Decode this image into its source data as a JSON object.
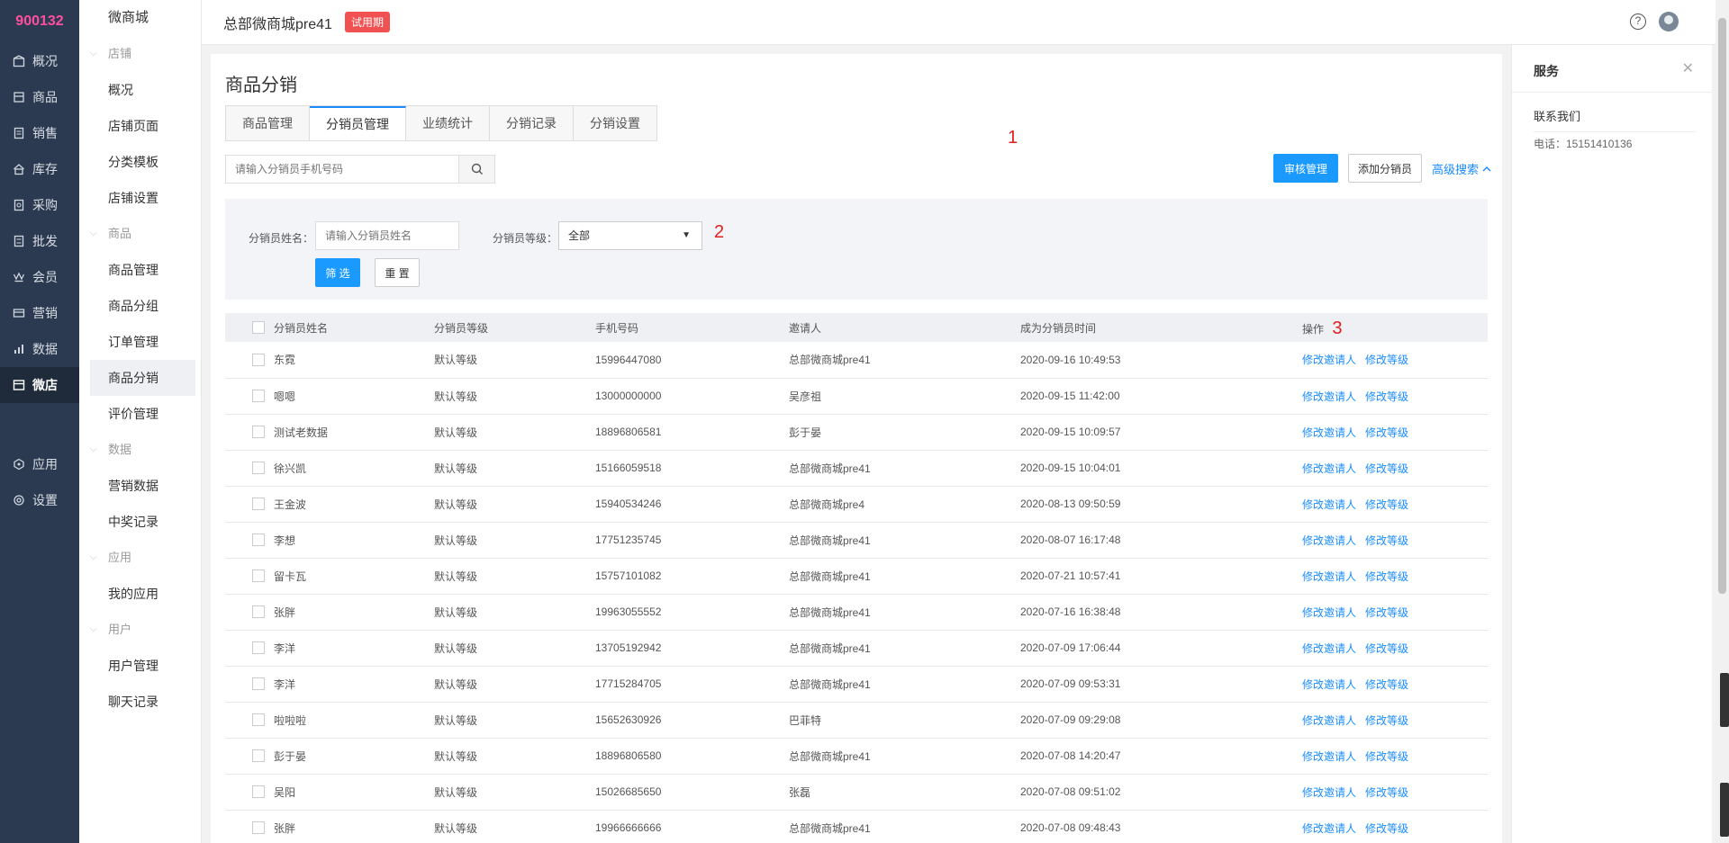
{
  "rail": {
    "store_id": "900132",
    "items": [
      {
        "label": "概况",
        "icon": "overview-icon"
      },
      {
        "label": "商品",
        "icon": "goods-icon"
      },
      {
        "label": "销售",
        "icon": "sales-icon"
      },
      {
        "label": "库存",
        "icon": "stock-icon"
      },
      {
        "label": "采购",
        "icon": "purchase-icon"
      },
      {
        "label": "批发",
        "icon": "wholesale-icon"
      },
      {
        "label": "会员",
        "icon": "member-icon"
      },
      {
        "label": "营销",
        "icon": "marketing-icon"
      },
      {
        "label": "数据",
        "icon": "data-icon"
      },
      {
        "label": "微店",
        "icon": "shop-icon"
      }
    ],
    "bottom_items": [
      {
        "label": "应用",
        "icon": "app-icon"
      },
      {
        "label": "设置",
        "icon": "settings-icon"
      }
    ]
  },
  "subnav": {
    "title": "微商城",
    "groups": [
      {
        "label": "店铺",
        "links": [
          "概况",
          "店铺页面",
          "分类模板",
          "店铺设置"
        ]
      },
      {
        "label": "商品",
        "links": [
          "商品管理",
          "商品分组",
          "订单管理",
          "商品分销",
          "评价管理"
        ]
      },
      {
        "label": "数据",
        "links": [
          "营销数据",
          "中奖记录"
        ]
      },
      {
        "label": "应用",
        "links": [
          "我的应用"
        ]
      },
      {
        "label": "用户",
        "links": [
          "用户管理",
          "聊天记录"
        ]
      }
    ]
  },
  "header": {
    "shop_name": "总部微商城pre41",
    "trial_badge": "试用期",
    "help": "?"
  },
  "main": {
    "page_title": "商品分销",
    "tabs": [
      "商品管理",
      "分销员管理",
      "业绩统计",
      "分销记录",
      "分销设置"
    ],
    "search_placeholder": "请输入分销员手机号码",
    "markers": [
      "1",
      "2",
      "3"
    ],
    "btn_review": "审核管理",
    "btn_add": "添加分销员",
    "advanced_search": "高级搜索",
    "filter": {
      "name_label": "分销员姓名：",
      "name_placeholder": "请输入分销员姓名",
      "level_label": "分销员等级：",
      "level_value": "全部",
      "btn_filter": "筛 选",
      "btn_reset": "重 置"
    },
    "table": {
      "columns": [
        "分销员姓名",
        "分销员等级",
        "手机号码",
        "邀请人",
        "成为分销员时间",
        "操作"
      ],
      "action_edit_inviter": "修改邀请人",
      "action_edit_level": "修改等级",
      "rows": [
        [
          "东霓",
          "默认等级",
          "15996447080",
          "总部微商城pre41",
          "2020-09-16 10:49:53"
        ],
        [
          "嗯嗯",
          "默认等级",
          "13000000000",
          "吴彦祖",
          "2020-09-15 11:42:00"
        ],
        [
          "测试老数据",
          "默认等级",
          "18896806581",
          "彭于晏",
          "2020-09-15 10:09:57"
        ],
        [
          "徐兴凯",
          "默认等级",
          "15166059518",
          "总部微商城pre41",
          "2020-09-15 10:04:01"
        ],
        [
          "王金波",
          "默认等级",
          "15940534246",
          "总部微商城pre4",
          "2020-08-13 09:50:59"
        ],
        [
          "李想",
          "默认等级",
          "17751235745",
          "总部微商城pre41",
          "2020-08-07 16:17:48"
        ],
        [
          "留卡瓦",
          "默认等级",
          "15757101082",
          "总部微商城pre41",
          "2020-07-21 10:57:41"
        ],
        [
          "张胖",
          "默认等级",
          "19963055552",
          "总部微商城pre41",
          "2020-07-16 16:38:48"
        ],
        [
          "李洋",
          "默认等级",
          "13705192942",
          "总部微商城pre41",
          "2020-07-09 17:06:44"
        ],
        [
          "李洋",
          "默认等级",
          "17715284705",
          "总部微商城pre41",
          "2020-07-09 09:53:31"
        ],
        [
          "啦啦啦",
          "默认等级",
          "15652630926",
          "巴菲特",
          "2020-07-09 09:29:08"
        ],
        [
          "彭于晏",
          "默认等级",
          "18896806580",
          "总部微商城pre41",
          "2020-07-08 14:20:47"
        ],
        [
          "吴阳",
          "默认等级",
          "15026685650",
          "张磊",
          "2020-07-08 09:51:02"
        ],
        [
          "张胖",
          "默认等级",
          "19966666666",
          "总部微商城pre41",
          "2020-07-08 09:48:43"
        ]
      ]
    }
  },
  "service": {
    "title": "服务",
    "contact": "联系我们",
    "phone": "电话：15151410136"
  },
  "colors": {
    "rail_bg": "#2b3a50",
    "store_id": "#ff4fa0",
    "primary": "#1a9aff",
    "trial": "#f25151",
    "marker": "#e02020"
  }
}
